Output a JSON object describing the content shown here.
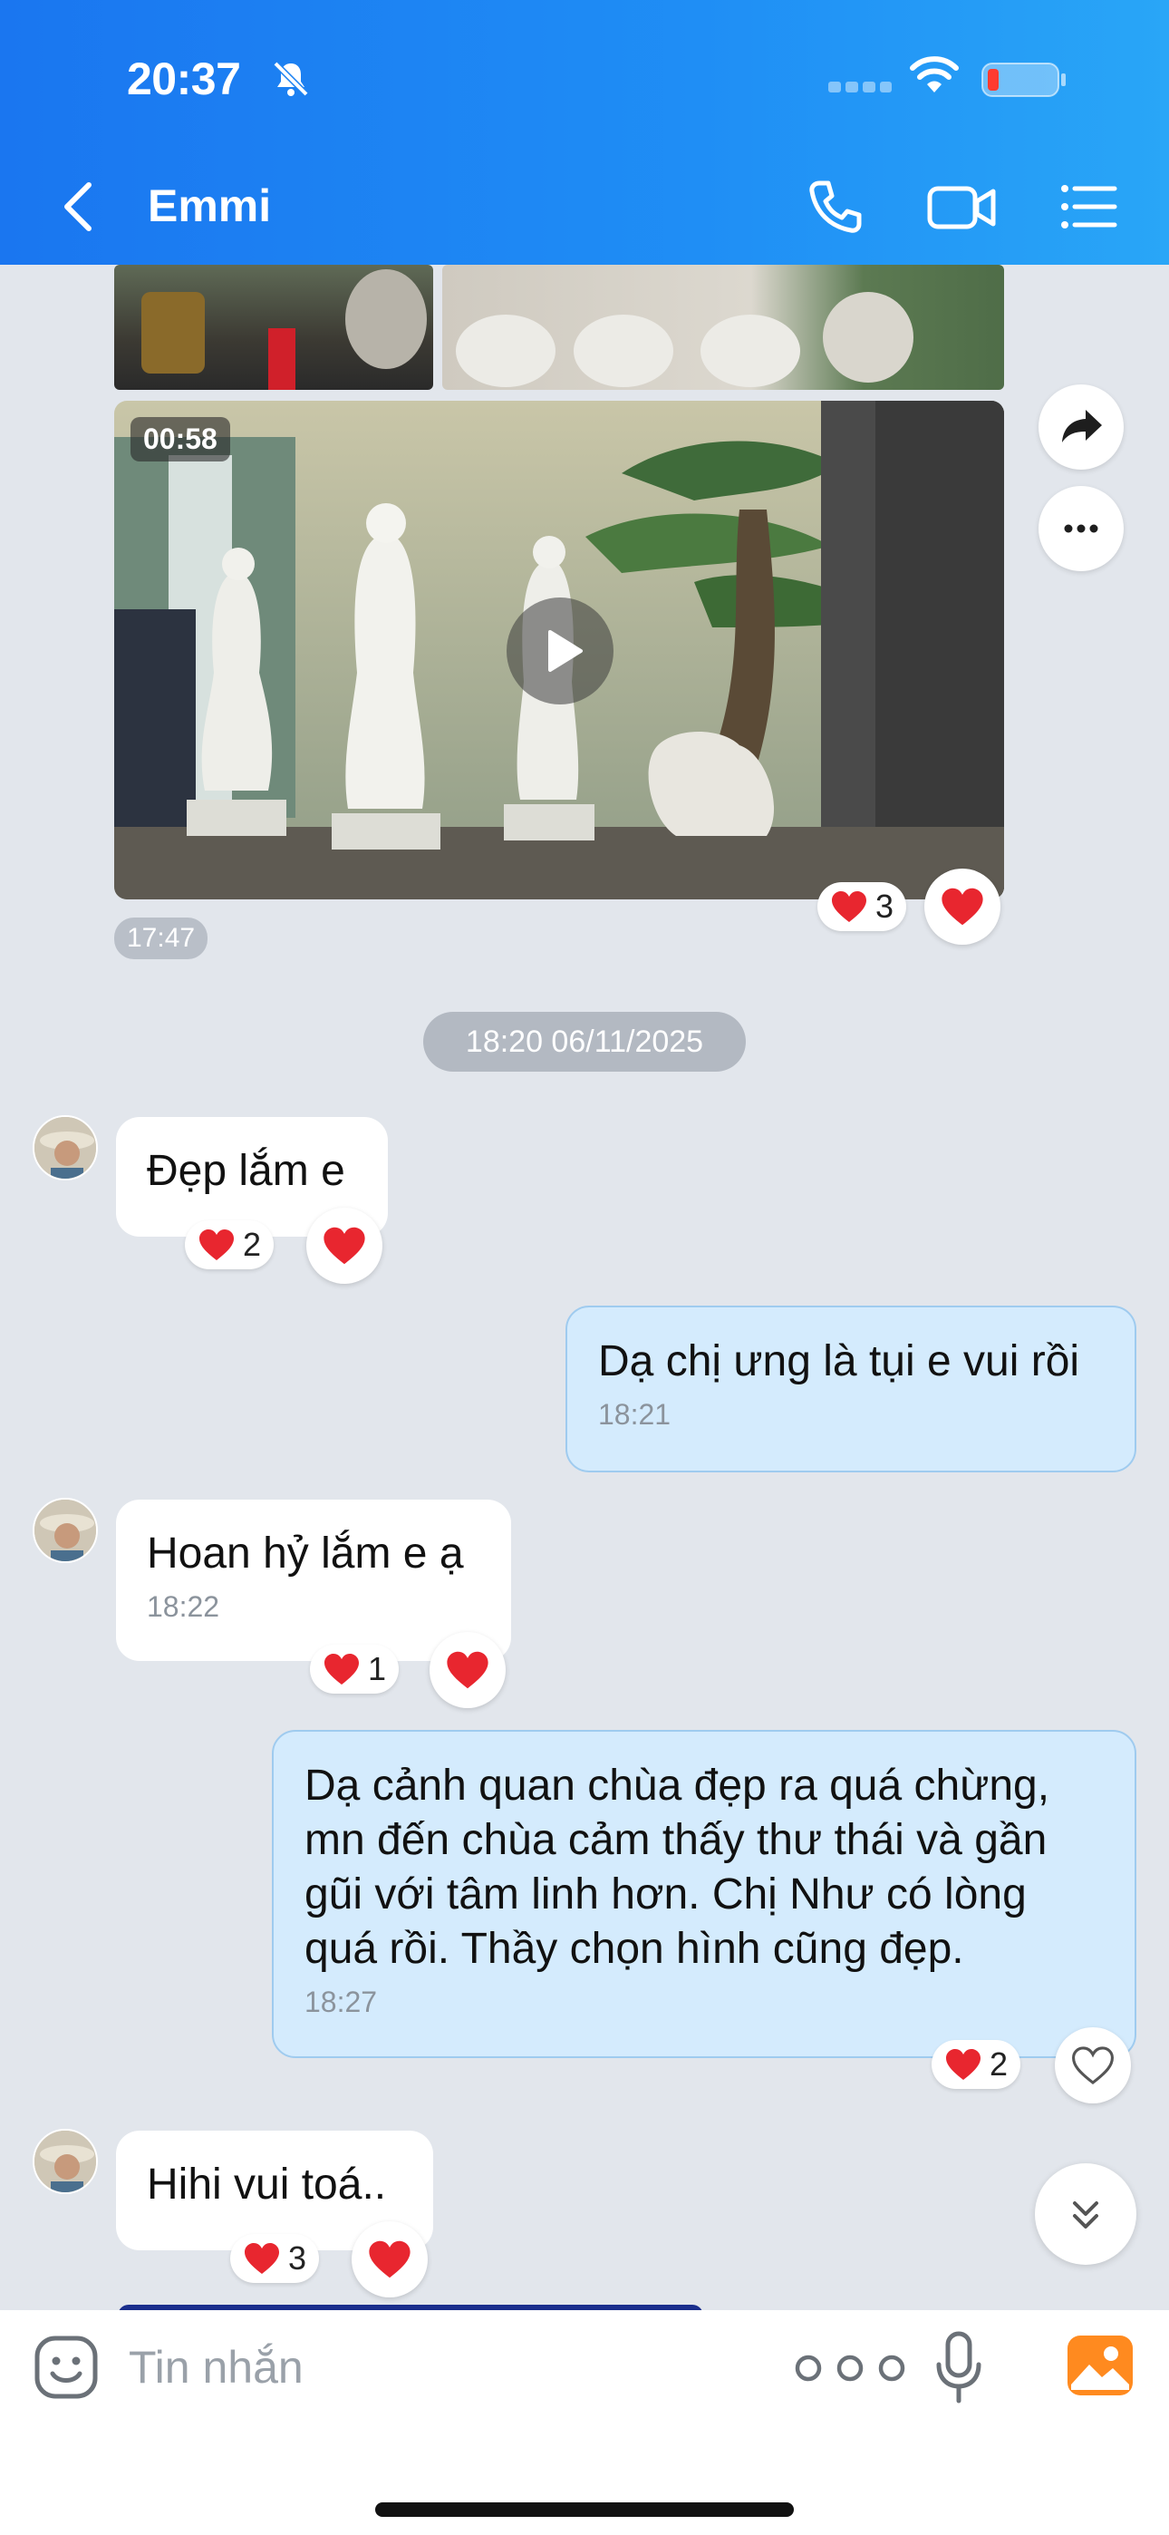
{
  "status_bar": {
    "time": "20:37"
  },
  "header": {
    "title": "Emmi",
    "icons": [
      "back-icon",
      "phone-icon",
      "video-call-icon",
      "menu-list-icon"
    ]
  },
  "media": {
    "video_duration": "00:58",
    "time": "17:47",
    "reaction_count": "3",
    "side_actions": [
      "share-icon",
      "more-options-icon"
    ]
  },
  "date_divider": "18:20 06/11/2025",
  "messages": [
    {
      "sender": "other",
      "text": "Đẹp lắm e",
      "time": "",
      "reaction_count": "2"
    },
    {
      "sender": "me",
      "text": "Dạ chị ưng là tụi e vui rồi",
      "time": "18:21"
    },
    {
      "sender": "other",
      "text": "Hoan hỷ lắm e ạ",
      "time": "18:22",
      "reaction_count": "1"
    },
    {
      "sender": "me",
      "text": "Dạ cảnh quan chùa đẹp ra quá chừng, mn đến chùa cảm thấy thư thái và gần gũi với tâm linh hơn. Chị Như có lòng quá rồi. Thầy chọn hình cũng đẹp.",
      "time": "18:27",
      "reaction_count": "2"
    },
    {
      "sender": "other",
      "text": "Hihi vui toá..",
      "time": "",
      "reaction_count": "3"
    }
  ],
  "input": {
    "placeholder": "Tin nhắn"
  },
  "colors": {
    "header_start": "#1a76f0",
    "header_end": "#29a6f7",
    "outgoing_bubble": "#d4ebfd",
    "heart": "#e8262f",
    "chat_bg": "#e2e6ec"
  }
}
